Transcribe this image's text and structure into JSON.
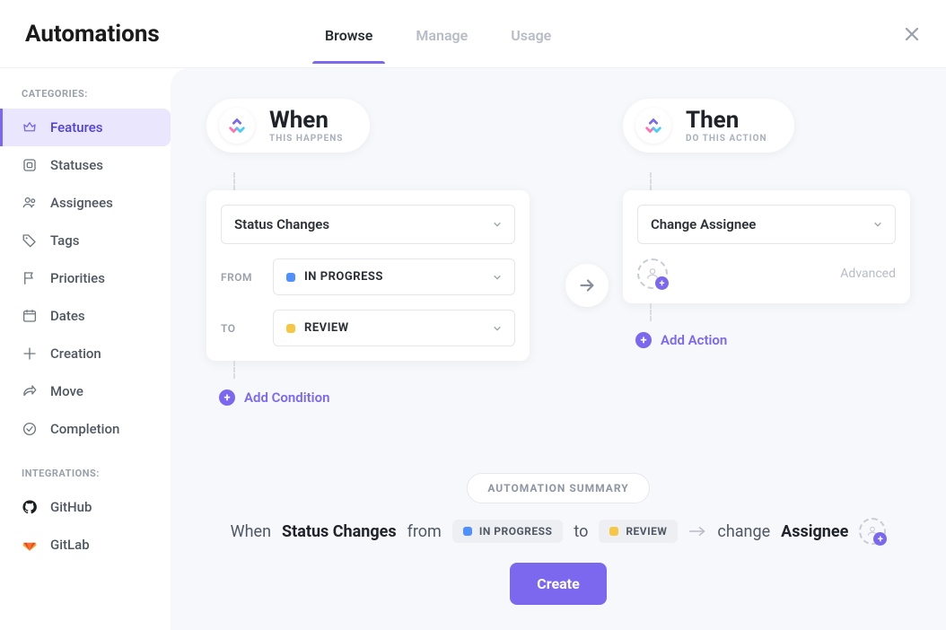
{
  "header": {
    "title": "Automations",
    "tabs": [
      "Browse",
      "Manage",
      "Usage"
    ],
    "active_tab": 0
  },
  "sidebar": {
    "categories_label": "CATEGORIES:",
    "integrations_label": "INTEGRATIONS:",
    "categories": [
      {
        "id": "features",
        "label": "Features",
        "active": true
      },
      {
        "id": "statuses",
        "label": "Statuses"
      },
      {
        "id": "assignees",
        "label": "Assignees"
      },
      {
        "id": "tags",
        "label": "Tags"
      },
      {
        "id": "priorities",
        "label": "Priorities"
      },
      {
        "id": "dates",
        "label": "Dates"
      },
      {
        "id": "creation",
        "label": "Creation"
      },
      {
        "id": "move",
        "label": "Move"
      },
      {
        "id": "completion",
        "label": "Completion"
      }
    ],
    "integrations": [
      {
        "id": "github",
        "label": "GitHub"
      },
      {
        "id": "gitlab",
        "label": "GitLab"
      }
    ]
  },
  "when": {
    "title": "When",
    "subtitle": "THIS HAPPENS",
    "trigger": "Status Changes",
    "from_label": "FROM",
    "from_status": "IN PROGRESS",
    "to_label": "TO",
    "to_status": "REVIEW",
    "add_condition": "Add Condition"
  },
  "then": {
    "title": "Then",
    "subtitle": "DO THIS ACTION",
    "action": "Change Assignee",
    "advanced": "Advanced",
    "add_action": "Add Action"
  },
  "summary": {
    "label": "AUTOMATION SUMMARY",
    "when": "When",
    "trigger": "Status Changes",
    "from": "from",
    "from_status": "IN PROGRESS",
    "to": "to",
    "to_status": "REVIEW",
    "change": "change",
    "target": "Assignee"
  },
  "buttons": {
    "create": "Create"
  }
}
